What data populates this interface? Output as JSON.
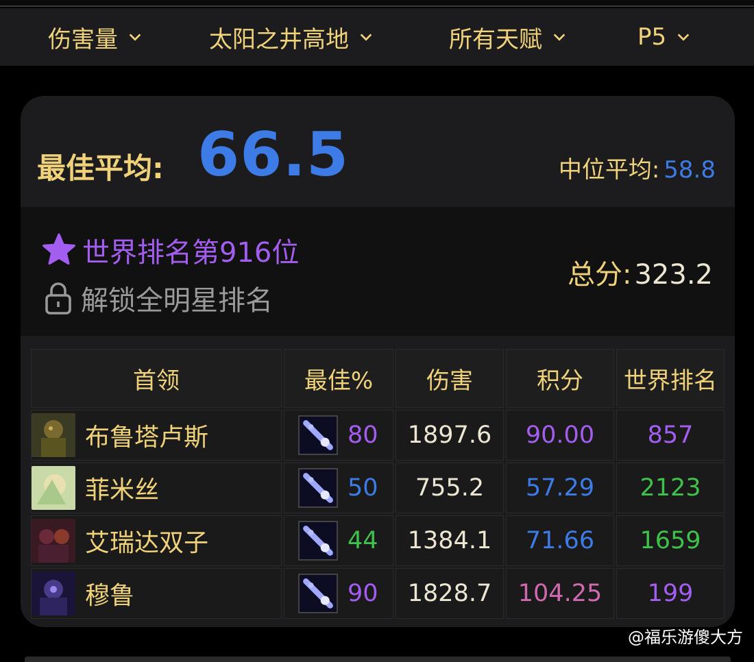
{
  "filters": [
    {
      "label": "伤害量"
    },
    {
      "label": "太阳之井高地"
    },
    {
      "label": "所有天赋"
    },
    {
      "label": "P5"
    }
  ],
  "summary": {
    "best_avg_label": "最佳平均:",
    "best_avg_value": "66.5",
    "median_label": "中位平均:",
    "median_value": "58.8"
  },
  "rank": {
    "world_rank_text": "世界排名第916位",
    "unlock_text": "解锁全明星排名",
    "total_label": "总分:",
    "total_value": "323.2"
  },
  "table": {
    "headers": [
      "首领",
      "最佳%",
      "伤害",
      "积分",
      "世界排名"
    ],
    "rows": [
      {
        "boss": "布鲁塔卢斯",
        "best": "80",
        "damage": "1897.6",
        "points": "90.00",
        "rank": "857"
      },
      {
        "boss": "菲米丝",
        "best": "50",
        "damage": "755.2",
        "points": "57.29",
        "rank": "2123"
      },
      {
        "boss": "艾瑞达双子",
        "best": "44",
        "damage": "1384.1",
        "points": "71.66",
        "rank": "1659"
      },
      {
        "boss": "穆鲁",
        "best": "90",
        "damage": "1828.7",
        "points": "104.25",
        "rank": "199"
      }
    ]
  },
  "watermark": "@福乐游傻大方",
  "colors": {
    "gold": "#f0d27a",
    "blue": "#3d7be6",
    "purple": "#a35ef0",
    "green": "#3fc24a",
    "pink": "#d06ab0"
  }
}
